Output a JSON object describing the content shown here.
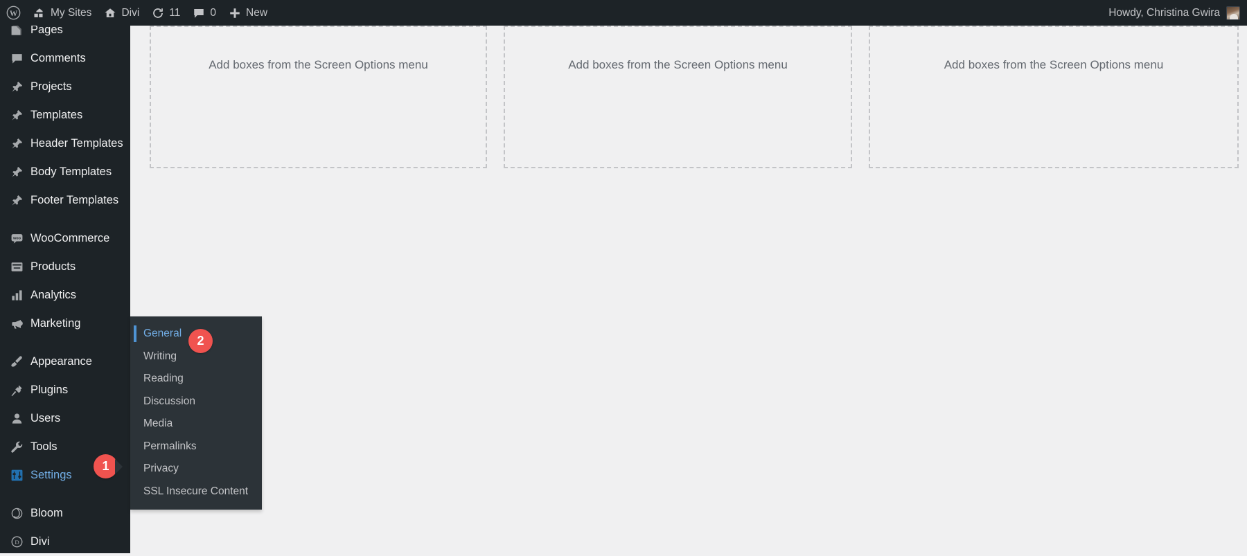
{
  "adminbar": {
    "left_items": [
      {
        "icon": "wordpress-logo-icon",
        "label": ""
      },
      {
        "icon": "my-sites-icon",
        "label": "My Sites"
      },
      {
        "icon": "site-home-icon",
        "label": "Divi"
      },
      {
        "icon": "updates-icon",
        "label": "11"
      },
      {
        "icon": "comments-bubble-icon",
        "label": "0"
      },
      {
        "icon": "plus-icon",
        "label": "New"
      }
    ],
    "howdy": "Howdy, Christina Gwira",
    "avatar_name": "user-avatar"
  },
  "sidebar": {
    "items": [
      {
        "label": "Pages",
        "icon": "pages-icon",
        "current": false,
        "separator_after": false
      },
      {
        "label": "Comments",
        "icon": "comments-icon",
        "current": false,
        "separator_after": false
      },
      {
        "label": "Projects",
        "icon": "pin-icon",
        "current": false,
        "separator_after": false
      },
      {
        "label": "Templates",
        "icon": "pin-icon",
        "current": false,
        "separator_after": false
      },
      {
        "label": "Header Templates",
        "icon": "pin-icon",
        "current": false,
        "separator_after": false
      },
      {
        "label": "Body Templates",
        "icon": "pin-icon",
        "current": false,
        "separator_after": false
      },
      {
        "label": "Footer Templates",
        "icon": "pin-icon",
        "current": false,
        "separator_after": true
      },
      {
        "label": "WooCommerce",
        "icon": "woocommerce-icon",
        "current": false,
        "separator_after": false
      },
      {
        "label": "Products",
        "icon": "products-box-icon",
        "current": false,
        "separator_after": false
      },
      {
        "label": "Analytics",
        "icon": "bar-chart-icon",
        "current": false,
        "separator_after": false
      },
      {
        "label": "Marketing",
        "icon": "megaphone-icon",
        "current": false,
        "separator_after": true
      },
      {
        "label": "Appearance",
        "icon": "paintbrush-icon",
        "current": false,
        "separator_after": false
      },
      {
        "label": "Plugins",
        "icon": "plug-icon",
        "current": false,
        "separator_after": false
      },
      {
        "label": "Users",
        "icon": "user-icon",
        "current": false,
        "separator_after": false
      },
      {
        "label": "Tools",
        "icon": "wrench-icon",
        "current": false,
        "separator_after": false
      },
      {
        "label": "Settings",
        "icon": "settings-sliders-icon",
        "current": true,
        "separator_after": true
      },
      {
        "label": "Bloom",
        "icon": "bloom-icon",
        "current": false,
        "separator_after": false
      },
      {
        "label": "Divi",
        "icon": "divi-circle-icon",
        "current": false,
        "separator_after": false
      }
    ]
  },
  "submenu": {
    "items": [
      {
        "label": "General",
        "current": true
      },
      {
        "label": "Writing",
        "current": false
      },
      {
        "label": "Reading",
        "current": false
      },
      {
        "label": "Discussion",
        "current": false
      },
      {
        "label": "Media",
        "current": false
      },
      {
        "label": "Permalinks",
        "current": false
      },
      {
        "label": "Privacy",
        "current": false
      },
      {
        "label": "SSL Insecure Content",
        "current": false
      }
    ]
  },
  "callouts": [
    {
      "number": "1",
      "target": "Settings"
    },
    {
      "number": "2",
      "target": "General"
    }
  ],
  "main": {
    "empty_boxes": [
      {
        "message": "Add boxes from the Screen Options menu"
      },
      {
        "message": "Add boxes from the Screen Options menu"
      },
      {
        "message": "Add boxes from the Screen Options menu"
      }
    ]
  },
  "colors": {
    "admin_dark": "#1d2327",
    "submenu_bg": "#2c3338",
    "accent_blue": "#72aee6",
    "badge_red": "#f0534f",
    "page_bg": "#f0f0f1",
    "dashed_border": "#c3c4c7"
  }
}
